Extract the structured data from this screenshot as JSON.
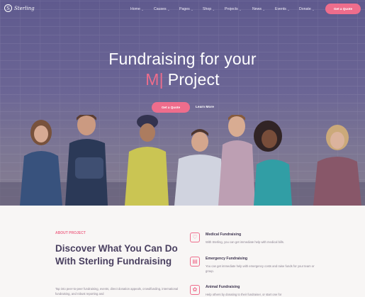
{
  "header": {
    "logo_text": "Sterling",
    "logo_mark": "S",
    "nav": [
      {
        "label": "Home",
        "chevron": "⌄"
      },
      {
        "label": "Causes",
        "chevron": "⌄"
      },
      {
        "label": "Pages",
        "chevron": "⌄"
      },
      {
        "label": "Shop",
        "chevron": "⌄"
      },
      {
        "label": "Projects",
        "chevron": "⌄"
      },
      {
        "label": "News",
        "chevron": "⌄"
      },
      {
        "label": "Events",
        "chevron": "⌄"
      },
      {
        "label": "Donate",
        "chevron": "⌄"
      }
    ],
    "cta_label": "Get a Quote"
  },
  "hero": {
    "title_line1": "Fundraising for your",
    "typed_text": "M",
    "cursor": "|",
    "title_word": "Project",
    "primary_cta": "Get a Quote",
    "secondary_cta": "Learn More"
  },
  "about": {
    "label": "ABOUT PROJECT",
    "heading": "Discover What You Can Do With Sterling Fundraising",
    "body": "Tap into peer-to-peer fundraising, events, direct donation appeals, crowdfunding, international fundraising, and robust reporting and"
  },
  "features": [
    {
      "icon": "medical-icon",
      "glyph": "♡",
      "title": "Medical Fundraising",
      "desc": "With Sterling, you can get immediate help with medical bills."
    },
    {
      "icon": "emergency-icon",
      "glyph": "▤",
      "title": "Emergency Fundraising",
      "desc": "You can get immediate help with emergency costs and raise funds for your team or group."
    },
    {
      "icon": "animal-icon",
      "glyph": "✿",
      "title": "Animal Fundraising",
      "desc": "Help others by donating to their fundraiser, or start one for"
    }
  ],
  "colors": {
    "accent": "#ee6d8c",
    "hero_overlay": "#625c90",
    "heading": "#4a4060",
    "section_bg": "#f8f6f5"
  }
}
